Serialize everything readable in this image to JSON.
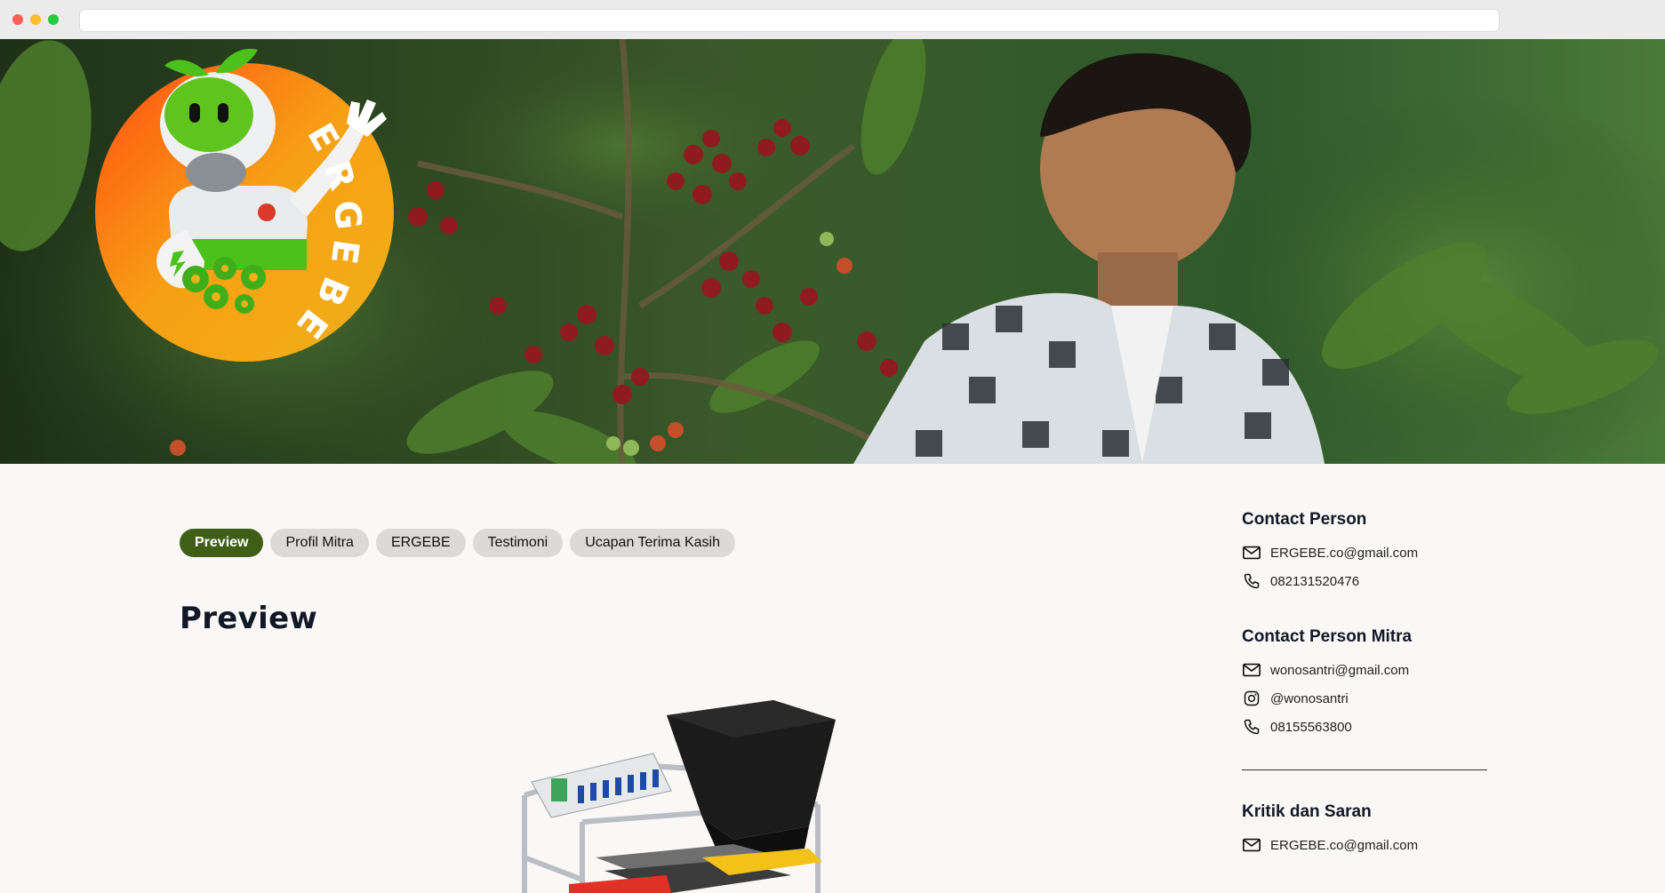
{
  "browser": {
    "url": ""
  },
  "logo": {
    "brand_text": "ERGEBE"
  },
  "tabs": [
    {
      "label": "Preview",
      "active": true
    },
    {
      "label": "Profil Mitra",
      "active": false
    },
    {
      "label": "ERGEBE",
      "active": false
    },
    {
      "label": "Testimoni",
      "active": false
    },
    {
      "label": "Ucapan Terima Kasih",
      "active": false
    }
  ],
  "main": {
    "title": "Preview"
  },
  "sidebar": {
    "contact_person": {
      "title": "Contact Person",
      "email": "ERGEBE.co@gmail.com",
      "phone": "082131520476"
    },
    "contact_person_mitra": {
      "title": "Contact Person Mitra",
      "email": "wonosantri@gmail.com",
      "instagram": "@wonosantri",
      "phone": "08155563800"
    },
    "kritik_saran": {
      "title": "Kritik dan Saran",
      "email": "ERGEBE.co@gmail.com"
    }
  },
  "colors": {
    "accent_active_tab": "#3f5f18",
    "tab_inactive": "#dcdad7",
    "page_bg": "#f9f8f6",
    "logo_orange": "#f39a12",
    "logo_green": "#5fc51e"
  },
  "icons": [
    "mail-icon",
    "phone-icon",
    "instagram-icon"
  ]
}
